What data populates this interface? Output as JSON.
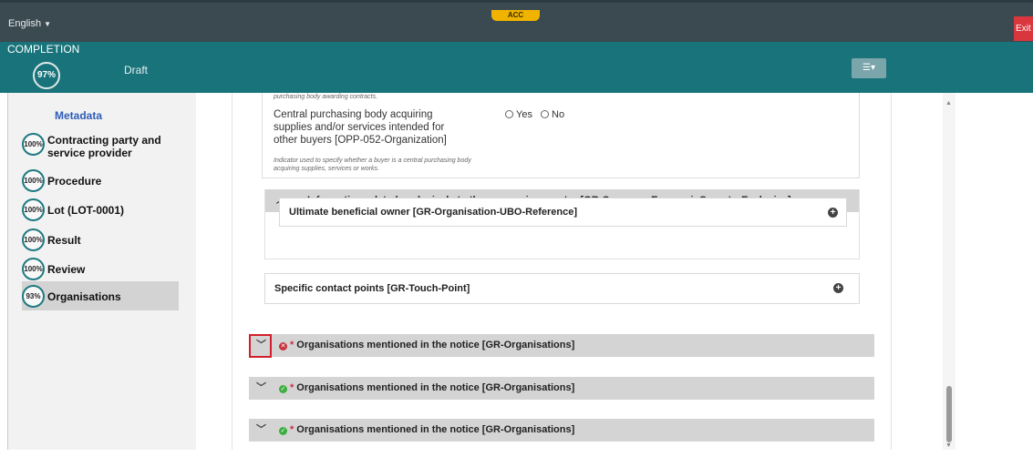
{
  "topbar": {
    "language": "English",
    "env_badge": "ACC",
    "exit_label": "Exit"
  },
  "completion": {
    "label": "COMPLETION",
    "percent": "97%",
    "status": "Draft"
  },
  "toolbar": {
    "filter_icon": "sliders-icon"
  },
  "sidebar": {
    "metadata_label": "Metadata",
    "items": [
      {
        "percent": "100%",
        "label": "Contracting party and service provider"
      },
      {
        "percent": "100%",
        "label": "Procedure"
      },
      {
        "percent": "100%",
        "label": "Lot (LOT-0001)"
      },
      {
        "percent": "100%",
        "label": "Result"
      },
      {
        "percent": "100%",
        "label": "Review"
      },
      {
        "percent": "93%",
        "label": "Organisations"
      }
    ]
  },
  "main": {
    "prev_note": "purchasing body awarding contracts.",
    "cpb_label": "Central purchasing body acquiring supplies and/or services intended for other buyers [OPP-052-Organization]",
    "cpb_note": "Indicator used to specify whether a buyer is a central purchasing body acquiring supplies, services or works.",
    "radio_yes": "Yes",
    "radio_no": "No",
    "eco_section": "Information related exclusively to the economic operator  [GR-Company-EconomicOperatorExclusive]",
    "ubo_label": "Ultimate beneficial owner  [GR-Organisation-UBO-Reference]",
    "touch_label": "Specific contact points  [GR-Touch-Point]",
    "org_sections": [
      {
        "required": "*",
        "title": "Organisations mentioned in the notice  [GR-Organisations]",
        "status": "error"
      },
      {
        "required": "*",
        "title": "Organisations mentioned in the notice  [GR-Organisations]",
        "status": "ok"
      },
      {
        "required": "*",
        "title": "Organisations mentioned in the notice  [GR-Organisations]",
        "status": "ok"
      }
    ]
  },
  "colors": {
    "accent": "#18737a",
    "header": "#3b4a51",
    "error": "#c8333b",
    "ok": "#3dae3f",
    "link": "#2f5cb8"
  }
}
